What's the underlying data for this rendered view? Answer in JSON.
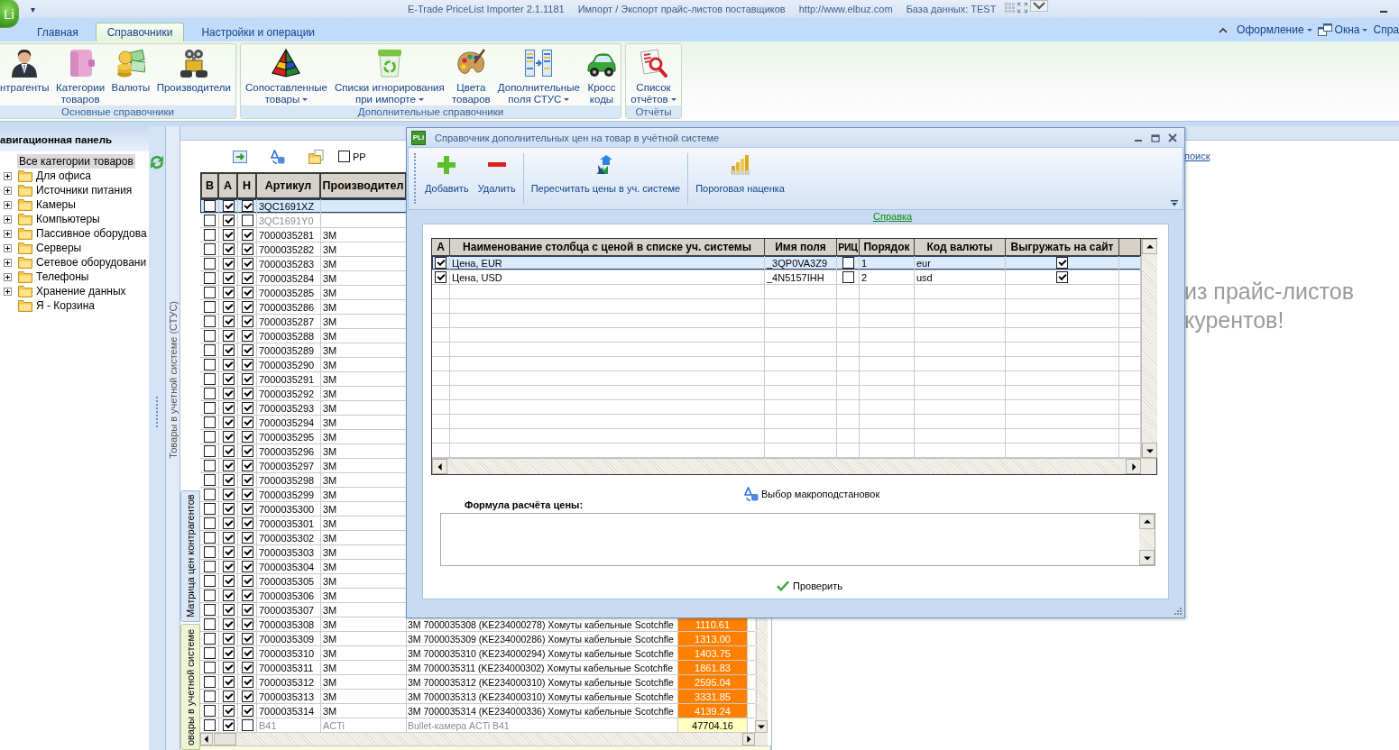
{
  "window": {
    "app_icon": "Li",
    "quick_access": "▾",
    "title_parts": [
      "E-Trade PriceList Importer 2.1.1181",
      "Импорт / Экспорт прайс-листов поставщиков",
      "http://www.elbuz.com",
      "База данных: TEST"
    ]
  },
  "ribbon": {
    "tabs": [
      {
        "label": "Главная",
        "selected": false
      },
      {
        "label": "Справочники",
        "selected": true
      },
      {
        "label": "Настройки и операции",
        "selected": false
      }
    ],
    "menu": [
      {
        "label": "Оформление",
        "dropdown": true
      },
      {
        "label": "Окна",
        "dropdown": true
      },
      {
        "label": "Спра",
        "dropdown": false
      }
    ],
    "groups": [
      {
        "label": "Основные справочники",
        "buttons": [
          {
            "lines": [
              "нтрагенты"
            ],
            "dropdown": false
          },
          {
            "lines": [
              "Категории",
              "товаров"
            ],
            "dropdown": false
          },
          {
            "lines": [
              "Валюты"
            ],
            "dropdown": false
          },
          {
            "lines": [
              "Производители"
            ],
            "dropdown": false
          }
        ]
      },
      {
        "label": "Дополнительные справочники",
        "buttons": [
          {
            "lines": [
              "Сопоставленные",
              "товары"
            ],
            "dropdown": true
          },
          {
            "lines": [
              "Списки игнорирования",
              "при импорте"
            ],
            "dropdown": true
          },
          {
            "lines": [
              "Цвета",
              "товаров"
            ],
            "dropdown": false
          },
          {
            "lines": [
              "Дополнительные",
              "поля СТУС"
            ],
            "dropdown": true
          },
          {
            "lines": [
              "Кросс",
              "коды"
            ],
            "dropdown": false
          }
        ]
      },
      {
        "label": "Отчёты",
        "buttons": [
          {
            "lines": [
              "Список",
              "отчётов"
            ],
            "dropdown": true
          }
        ]
      }
    ]
  },
  "nav": {
    "title": "авигационная панель",
    "tree": [
      {
        "label": "Все категории товаров",
        "selected": true,
        "children": [
          {
            "label": "Для офиса",
            "selected": false,
            "expandable": true
          },
          {
            "label": "Источники питания",
            "selected": false,
            "expandable": true
          },
          {
            "label": "Камеры",
            "selected": false,
            "expandable": true
          },
          {
            "label": "Компьютеры",
            "selected": false,
            "expandable": true
          },
          {
            "label": "Пассивное оборудова",
            "selected": false,
            "expandable": true
          },
          {
            "label": "Серверы",
            "selected": false,
            "expandable": true
          },
          {
            "label": "Сетевое оборудовани",
            "selected": false,
            "expandable": true
          },
          {
            "label": "Телефоны",
            "selected": false,
            "expandable": true
          },
          {
            "label": "Хранение данных",
            "selected": false,
            "expandable": true
          },
          {
            "label": "Я - Корзина",
            "selected": false,
            "expandable": false
          }
        ]
      }
    ]
  },
  "products": {
    "caption": "Товары в учетной системе (СТУС)",
    "pp": {
      "label": "PP",
      "checked": false
    },
    "columns": [
      "В",
      "А",
      "Н",
      "Артикул",
      "Производител"
    ],
    "rows": [
      {
        "checks": [
          false,
          true,
          true
        ],
        "article": "3QC1691XZ",
        "selected": true,
        "inactive": false
      },
      {
        "checks": [
          false,
          true,
          false
        ],
        "article": "3QC1691Y0",
        "selected": false,
        "inactive": true
      },
      {
        "checks": [
          false,
          true,
          true
        ],
        "article": "7000035281",
        "maker": "3M",
        "selected": false,
        "inactive": false
      },
      {
        "checks": [
          false,
          true,
          true
        ],
        "article": "7000035282",
        "maker": "3M",
        "selected": false,
        "inactive": false
      },
      {
        "checks": [
          false,
          true,
          true
        ],
        "article": "7000035283",
        "maker": "3M",
        "selected": false,
        "inactive": false
      },
      {
        "checks": [
          false,
          true,
          true
        ],
        "article": "7000035284",
        "maker": "3M",
        "selected": false,
        "inactive": false
      },
      {
        "checks": [
          false,
          true,
          true
        ],
        "article": "7000035285",
        "maker": "3M",
        "selected": false,
        "inactive": false
      },
      {
        "checks": [
          false,
          true,
          true
        ],
        "article": "7000035286",
        "maker": "3M",
        "selected": false,
        "inactive": false
      },
      {
        "checks": [
          false,
          true,
          true
        ],
        "article": "7000035287",
        "maker": "3M",
        "selected": false,
        "inactive": false
      },
      {
        "checks": [
          false,
          true,
          true
        ],
        "article": "7000035288",
        "maker": "3M",
        "selected": false,
        "inactive": false
      },
      {
        "checks": [
          false,
          true,
          true
        ],
        "article": "7000035289",
        "maker": "3M",
        "selected": false,
        "inactive": false
      },
      {
        "checks": [
          false,
          true,
          true
        ],
        "article": "7000035290",
        "maker": "3M",
        "selected": false,
        "inactive": false
      },
      {
        "checks": [
          false,
          true,
          true
        ],
        "article": "7000035291",
        "maker": "3M",
        "selected": false,
        "inactive": false
      },
      {
        "checks": [
          false,
          true,
          true
        ],
        "article": "7000035292",
        "maker": "3M",
        "selected": false,
        "inactive": false
      },
      {
        "checks": [
          false,
          true,
          true
        ],
        "article": "7000035293",
        "maker": "3M",
        "selected": false,
        "inactive": false
      },
      {
        "checks": [
          false,
          true,
          true
        ],
        "article": "7000035294",
        "maker": "3M",
        "selected": false,
        "inactive": false
      },
      {
        "checks": [
          false,
          true,
          true
        ],
        "article": "7000035295",
        "maker": "3M",
        "selected": false,
        "inactive": false
      },
      {
        "checks": [
          false,
          true,
          true
        ],
        "article": "7000035296",
        "maker": "3M",
        "selected": false,
        "inactive": false
      },
      {
        "checks": [
          false,
          true,
          true
        ],
        "article": "7000035297",
        "maker": "3M",
        "selected": false,
        "inactive": false
      },
      {
        "checks": [
          false,
          true,
          true
        ],
        "article": "7000035298",
        "maker": "3M",
        "selected": false,
        "inactive": false
      },
      {
        "checks": [
          false,
          true,
          true
        ],
        "article": "7000035299",
        "maker": "3M",
        "selected": false,
        "inactive": false
      },
      {
        "checks": [
          false,
          true,
          true
        ],
        "article": "7000035300",
        "maker": "3M",
        "selected": false,
        "inactive": false
      },
      {
        "checks": [
          false,
          true,
          true
        ],
        "article": "7000035301",
        "maker": "3M",
        "selected": false,
        "inactive": false
      },
      {
        "checks": [
          false,
          true,
          true
        ],
        "article": "7000035302",
        "maker": "3M",
        "selected": false,
        "inactive": false
      },
      {
        "checks": [
          false,
          true,
          true
        ],
        "article": "7000035303",
        "maker": "3M",
        "selected": false,
        "inactive": false
      },
      {
        "checks": [
          false,
          true,
          true
        ],
        "article": "7000035304",
        "maker": "3M",
        "selected": false,
        "inactive": false
      },
      {
        "checks": [
          false,
          true,
          true
        ],
        "article": "7000035305",
        "maker": "3M",
        "selected": false,
        "inactive": false
      },
      {
        "checks": [
          false,
          true,
          true
        ],
        "article": "7000035306",
        "maker": "3M",
        "selected": false,
        "inactive": false
      },
      {
        "checks": [
          false,
          true,
          true
        ],
        "article": "7000035307",
        "maker": "3M",
        "selected": false,
        "inactive": false
      },
      {
        "checks": [
          false,
          true,
          true
        ],
        "article": "7000035308",
        "maker": "3M",
        "description": "3M 7000035308 (KE234000278) Хомуты кабельные Scotchfle",
        "price": "1110.61",
        "color": "#ff8000",
        "selected": false,
        "inactive": false
      },
      {
        "checks": [
          false,
          true,
          true
        ],
        "article": "7000035309",
        "maker": "3M",
        "description": "3M 7000035309 (KE234000286) Хомуты кабельные Scotchfle",
        "price": "1313.00",
        "color": "#ff8000",
        "selected": false,
        "inactive": false
      },
      {
        "checks": [
          false,
          true,
          true
        ],
        "article": "7000035310",
        "maker": "3M",
        "description": "3M 7000035310 (KE234000294) Хомуты кабельные Scotchfle",
        "price": "1403.75",
        "color": "#ff8000",
        "selected": false,
        "inactive": false
      },
      {
        "checks": [
          false,
          true,
          true
        ],
        "article": "7000035311",
        "maker": "3M",
        "description": "3M 7000035311 (KE234000302) Хомуты кабельные Scotchfle",
        "price": "1861.83",
        "color": "#ff8000",
        "selected": false,
        "inactive": false
      },
      {
        "checks": [
          false,
          true,
          true
        ],
        "article": "7000035312",
        "maker": "3M",
        "description": "3M 7000035312 (KE234000310) Хомуты кабельные Scotchfle",
        "price": "2595.04",
        "color": "#ff8000",
        "selected": false,
        "inactive": false
      },
      {
        "checks": [
          false,
          true,
          true
        ],
        "article": "7000035313",
        "maker": "3M",
        "description": "3M 7000035313 (KE234000310) Хомуты кабельные Scotchfle",
        "price": "3331.85",
        "color": "#ff8000",
        "selected": false,
        "inactive": false
      },
      {
        "checks": [
          false,
          true,
          true
        ],
        "article": "7000035314",
        "maker": "3M",
        "description": "3M 7000035314 (KE234000336) Хомуты кабельные Scotchfle",
        "price": "4139.24",
        "color": "#ff8000",
        "selected": false,
        "inactive": false
      },
      {
        "checks": [
          false,
          true,
          false
        ],
        "article": "B41",
        "maker": "ACTi",
        "description": "Bullet-камера ACTi B41",
        "price": "47704.16",
        "color": "#ffffc0",
        "selected": false,
        "inactive": true
      }
    ],
    "side_tabs": [
      {
        "label": "Матрица цен контрагентов",
        "selected": false
      },
      {
        "label": "овары в учетной системе",
        "selected": true
      }
    ]
  },
  "background_page": {
    "link": "поиск",
    "lines": [
      "из прайс-листов",
      "курентов!"
    ]
  },
  "dialog": {
    "icon_text": "PLi",
    "title": "Справочник дополнительных цен на товар в учётной системе",
    "toolbar": [
      {
        "buttons": [
          {
            "label": "Добавить"
          },
          {
            "label": "Удалить"
          }
        ]
      },
      {
        "buttons": [
          {
            "label": "Пересчитать цены в уч. системе"
          }
        ]
      },
      {
        "buttons": [
          {
            "label": "Пороговая наценка"
          }
        ]
      }
    ],
    "help_link": "Справка",
    "grid": {
      "columns": [
        "А",
        "Наименование столбца с ценой в списке уч. системы",
        "Имя поля",
        "РИЦ",
        "Порядок",
        "Код валюты",
        "Выгружать на сайт"
      ],
      "rows": [
        {
          "active": true,
          "name": "Цена, EUR",
          "field": "_3QP0VA3Z9",
          "ric": false,
          "order": "1",
          "currency": "eur",
          "export": true,
          "selected": true
        },
        {
          "active": true,
          "name": "Цена, USD",
          "field": "_4N5157IHH",
          "ric": false,
          "order": "2",
          "currency": "usd",
          "export": true,
          "selected": false
        }
      ]
    },
    "macro_button": "Выбор макроподстановок",
    "formula_label": "Формула расчёта цены:",
    "check_button": "Проверить"
  }
}
